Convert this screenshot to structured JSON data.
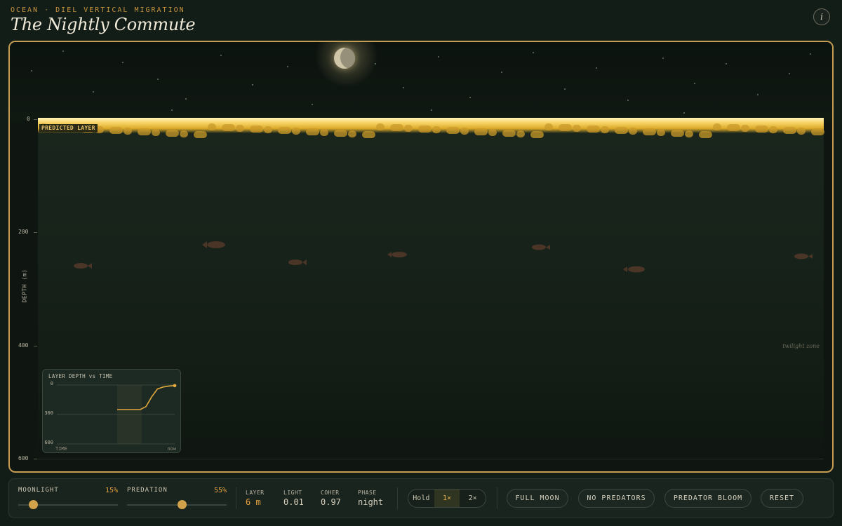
{
  "header": {
    "eyebrow": "OCEAN · DIEL VERTICAL MIGRATION",
    "title": "The Nightly Commute",
    "info_icon": "info-icon"
  },
  "stage": {
    "predicted_label": "PREDICTED LAYER",
    "depth_axis_label": "DEPTH (m)",
    "depth_ticks": [
      "0",
      "200",
      "400",
      "600"
    ],
    "zone_label": "twilight zone",
    "moon_icon": "crescent-moon-icon",
    "colors": {
      "border": "#c59c52",
      "layer": "#f6d160",
      "fish": "#4a3527"
    }
  },
  "minichart": {
    "title": "LAYER DEPTH vs TIME",
    "ticks": [
      "0",
      "300",
      "600"
    ],
    "x_start_label": "TIME",
    "x_end_label": "now"
  },
  "chart_data": {
    "type": "line",
    "title": "LAYER DEPTH vs TIME",
    "xlabel": "TIME",
    "ylabel": "",
    "ylim": [
      600,
      0
    ],
    "series": [
      {
        "values": [
          250,
          250,
          250,
          250,
          250,
          220,
          120,
          40,
          20,
          10,
          6
        ]
      }
    ]
  },
  "controls": {
    "moonlight": {
      "label": "MOONLIGHT",
      "value": "15%",
      "fraction": 0.15
    },
    "predation": {
      "label": "PREDATION",
      "value": "55%",
      "fraction": 0.55
    },
    "stats": [
      {
        "key": "LAYER",
        "value": "6 m",
        "highlight": true
      },
      {
        "key": "LIGHT",
        "value": "0.01"
      },
      {
        "key": "COHER",
        "value": "0.97"
      },
      {
        "key": "PHASE",
        "value": "night"
      }
    ],
    "speed": {
      "options": [
        "Hold",
        "1×",
        "2×"
      ],
      "selected": "1×"
    },
    "buttons": [
      "FULL MOON",
      "NO PREDATORS",
      "PREDATOR BLOOM",
      "RESET"
    ]
  }
}
